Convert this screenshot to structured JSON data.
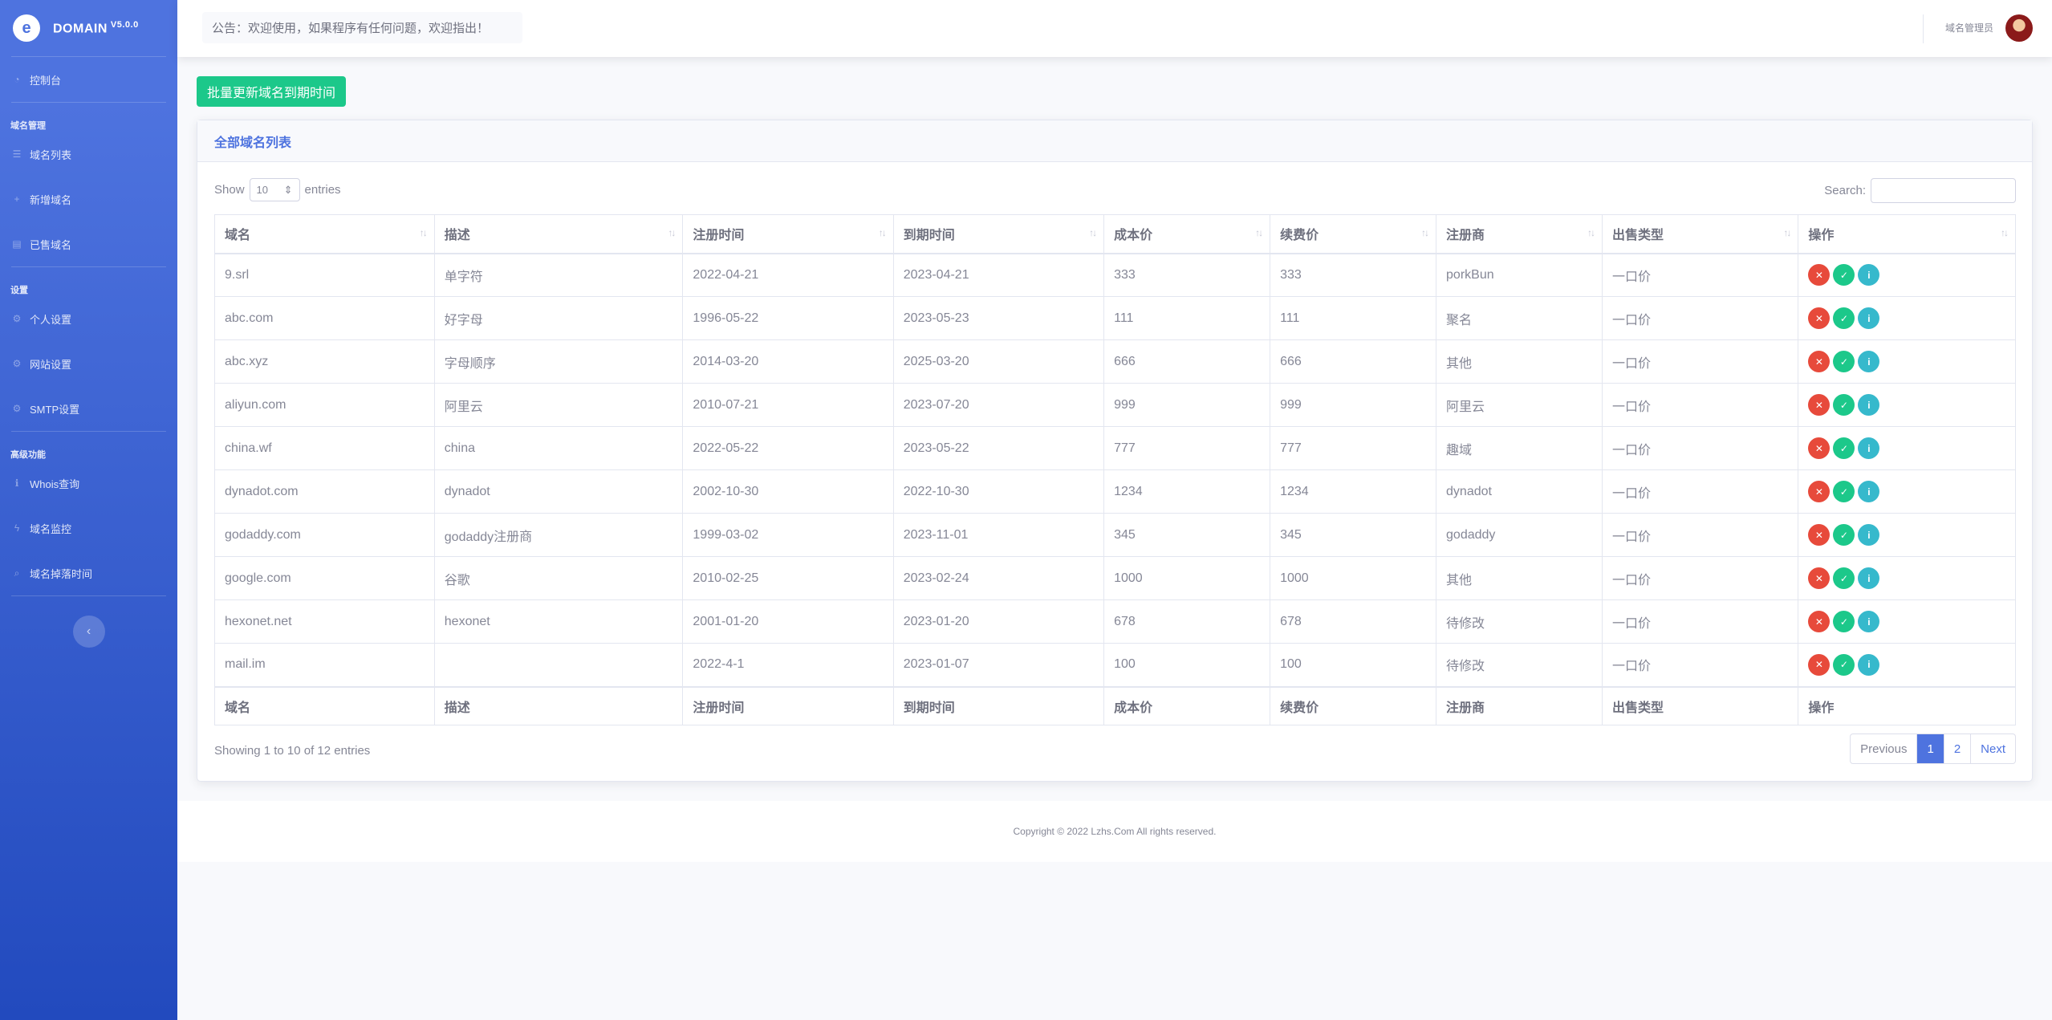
{
  "brand": {
    "name": "DOMAIN",
    "version": "V5.0.0",
    "logo_glyph": "e"
  },
  "sidebar": {
    "dashboard": "控制台",
    "sections": [
      {
        "title": "域名管理",
        "items": [
          {
            "label": "域名列表",
            "icon": "list-icon"
          },
          {
            "label": "新增域名",
            "icon": "plus-icon"
          },
          {
            "label": "已售域名",
            "icon": "sold-icon"
          }
        ]
      },
      {
        "title": "设置",
        "items": [
          {
            "label": "个人设置",
            "icon": "gear-icon"
          },
          {
            "label": "网站设置",
            "icon": "gear-icon"
          },
          {
            "label": "SMTP设置",
            "icon": "gear-icon"
          }
        ]
      },
      {
        "title": "高级功能",
        "items": [
          {
            "label": "Whois查询",
            "icon": "info-icon"
          },
          {
            "label": "域名监控",
            "icon": "bolt-icon"
          },
          {
            "label": "域名掉落时间",
            "icon": "search-icon"
          }
        ]
      }
    ],
    "toggle": "‹"
  },
  "topbar": {
    "notice": "公告：欢迎使用，如果程序有任何问题，欢迎指出！",
    "user": "域名管理员"
  },
  "bulk_button": "批量更新域名到期时间",
  "card": {
    "title": "全部域名列表",
    "length": {
      "show": "Show",
      "value": "10",
      "entries": "entries"
    },
    "search_label": "Search:",
    "columns": [
      "域名",
      "描述",
      "注册时间",
      "到期时间",
      "成本价",
      "续费价",
      "注册商",
      "出售类型",
      "操作"
    ],
    "rows": [
      [
        "9.srl",
        "单字符",
        "2022-04-21",
        "2023-04-21",
        "333",
        "333",
        "porkBun",
        "一口价"
      ],
      [
        "abc.com",
        "好字母",
        "1996-05-22",
        "2023-05-23",
        "111",
        "111",
        "聚名",
        "一口价"
      ],
      [
        "abc.xyz",
        "字母顺序",
        "2014-03-20",
        "2025-03-20",
        "666",
        "666",
        "其他",
        "一口价"
      ],
      [
        "aliyun.com",
        "阿里云",
        "2010-07-21",
        "2023-07-20",
        "999",
        "999",
        "阿里云",
        "一口价"
      ],
      [
        "china.wf",
        "china",
        "2022-05-22",
        "2023-05-22",
        "777",
        "777",
        "趣域",
        "一口价"
      ],
      [
        "dynadot.com",
        "dynadot",
        "2002-10-30",
        "2022-10-30",
        "1234",
        "1234",
        "dynadot",
        "一口价"
      ],
      [
        "godaddy.com",
        "godaddy注册商",
        "1999-03-02",
        "2023-11-01",
        "345",
        "345",
        "godaddy",
        "一口价"
      ],
      [
        "google.com",
        "谷歌",
        "2010-02-25",
        "2023-02-24",
        "1000",
        "1000",
        "其他",
        "一口价"
      ],
      [
        "hexonet.net",
        "hexonet",
        "2001-01-20",
        "2023-01-20",
        "678",
        "678",
        "待修改",
        "一口价"
      ],
      [
        "mail.im",
        "",
        "2022-4-1",
        "2023-01-07",
        "100",
        "100",
        "待修改",
        "一口价"
      ]
    ],
    "info": "Showing 1 to 10 of 12 entries",
    "pager": {
      "previous": "Previous",
      "pages": [
        "1",
        "2"
      ],
      "next": "Next"
    }
  },
  "footer": "Copyright © 2022 Lzhs.Com All rights reserved.",
  "colors": {
    "primary": "#4e73df",
    "success": "#1cc88a",
    "danger": "#e74a3b",
    "info": "#36b9cc"
  }
}
